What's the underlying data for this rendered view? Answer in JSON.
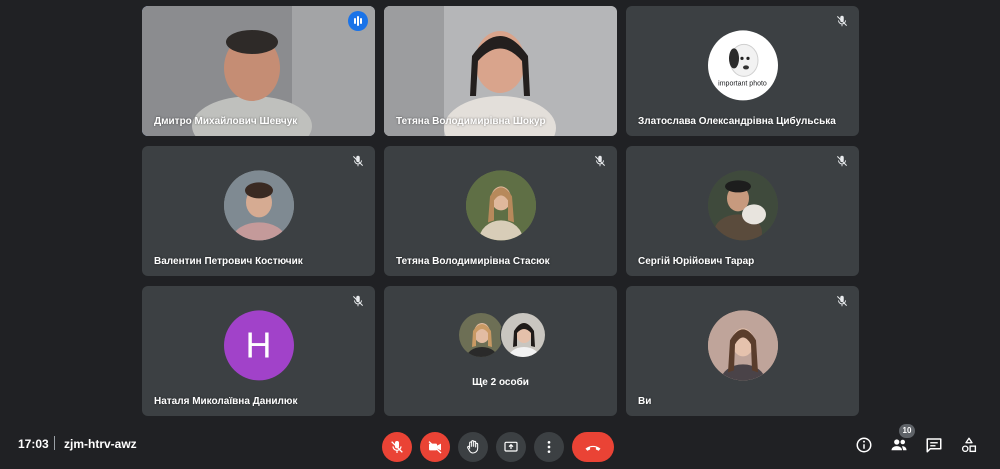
{
  "participants": [
    {
      "name": "Дмитро Михайлович Шевчук",
      "state": "speaking"
    },
    {
      "name": "Тетяна Володимирівна Шокур",
      "state": "video"
    },
    {
      "name": "Златослава Олександрівна Цибульська",
      "state": "muted",
      "avatar_caption": "important photo"
    },
    {
      "name": "Валентин Петрович Костючик",
      "state": "muted"
    },
    {
      "name": "Тетяна Володимирівна Стасюк",
      "state": "muted"
    },
    {
      "name": "Сергій Юрійович Тарар",
      "state": "muted"
    },
    {
      "name": "Наталя Миколаївна Данилюк",
      "state": "muted",
      "avatar_letter": "Н"
    },
    {
      "name": "Ще 2 особи",
      "state": "group"
    },
    {
      "name": "Ви",
      "state": "muted"
    }
  ],
  "footer": {
    "time": "17:03",
    "meeting_code": "zjm-htrv-awz",
    "participant_count": "10"
  },
  "colors": {
    "background": "#202124",
    "tile": "#3c4043",
    "danger": "#ea4335",
    "active_speaker": "#8ab4f8",
    "letter_avatar": "#a142c9"
  },
  "icons": {
    "mic": "mic-off-icon",
    "camera": "camera-off-icon",
    "hand": "raise-hand-icon",
    "present": "present-screen-icon",
    "more": "more-options-icon",
    "leave": "hang-up-icon",
    "info": "info-icon",
    "people": "people-icon",
    "chat": "chat-icon",
    "activities": "activities-icon"
  }
}
